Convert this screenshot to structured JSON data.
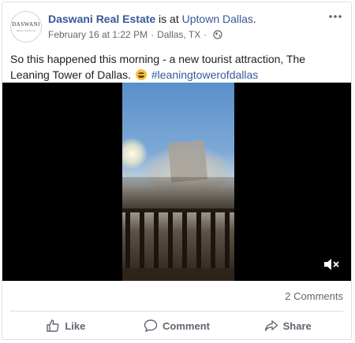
{
  "post": {
    "author": "Daswani Real Estate",
    "checkin_connector": " is at ",
    "location_name": "Uptown Dallas",
    "location_suffix": ".",
    "date": "February 16 at 1:22 PM",
    "separator": "·",
    "city": "Dallas, TX",
    "separator2": "·",
    "privacy_icon": "globe-icon",
    "text_part1": "So this happened this morning - a new tourist attraction, The Leaning Tower of Dallas.",
    "emoji_icon": "laughing-emoji-icon",
    "hashtag": "#leaningtowerofdallas"
  },
  "avatar": {
    "logo_word": "DASWANI",
    "logo_sub": "REAL ESTATE"
  },
  "video": {
    "mute_icon": "speaker-muted-icon"
  },
  "stats": {
    "comments": "2 Comments"
  },
  "actions": {
    "like": "Like",
    "comment": "Comment",
    "share": "Share"
  },
  "colors": {
    "link": "#385898",
    "secondary_text": "#606770",
    "border": "#dddfe2"
  }
}
